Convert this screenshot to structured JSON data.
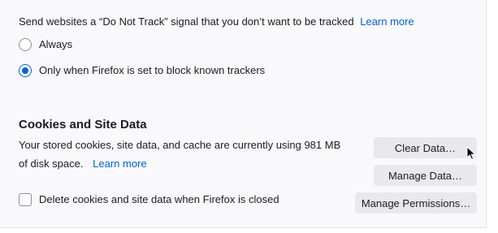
{
  "dnt": {
    "description": "Send websites a “Do Not Track” signal that you don’t want to be tracked",
    "learn_more": "Learn more",
    "options": [
      {
        "label": "Always",
        "checked": false
      },
      {
        "label": "Only when Firefox is set to block known trackers",
        "checked": true
      }
    ]
  },
  "cookies": {
    "heading": "Cookies and Site Data",
    "description_line1": "Your stored cookies, site data, and cache are currently using 981 MB",
    "description_line2": "of disk space.",
    "learn_more": "Learn more",
    "clear_data_label": "Clear Data…",
    "manage_data_label": "Manage Data…",
    "manage_permissions_label": "Manage Permissions…",
    "delete_on_close_label": "Delete cookies and site data when Firefox is closed",
    "delete_on_close_checked": false
  },
  "colors": {
    "accent": "#0061e0",
    "button_bg": "#e9e9ed",
    "background": "#f9f9fb"
  },
  "icons": {
    "cursor": "mouse-pointer-icon"
  }
}
